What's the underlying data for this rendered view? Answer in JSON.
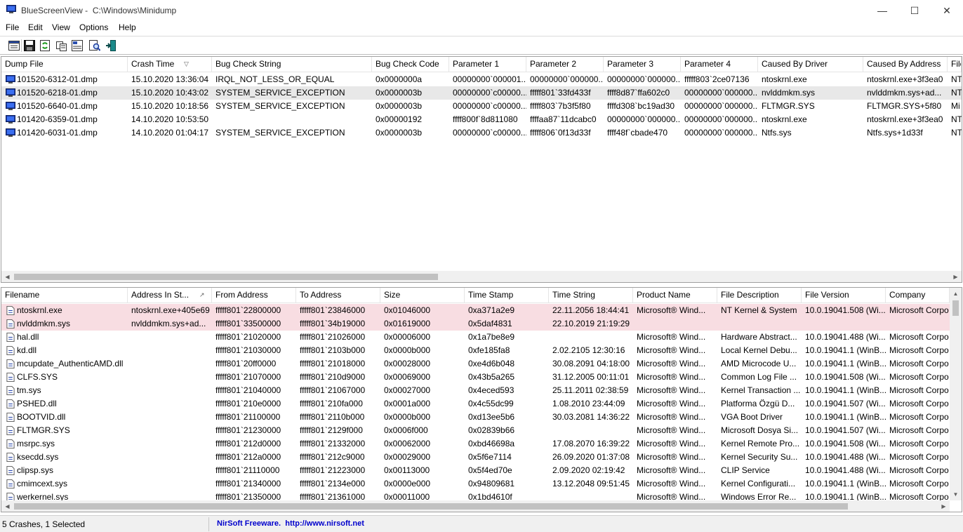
{
  "window": {
    "app_name": "BlueScreenView",
    "path": "C:\\Windows\\Minidump",
    "minimize": "—",
    "maximize": "☐",
    "close": "✕"
  },
  "menu": [
    "File",
    "Edit",
    "View",
    "Options",
    "Help"
  ],
  "toolbar": {
    "icons": [
      "options-icon",
      "save-icon",
      "refresh-icon",
      "copy-icon",
      "properties-icon",
      "find-icon",
      "exit-icon"
    ]
  },
  "crashes": {
    "columns": [
      "Dump File",
      "Crash Time",
      "Bug Check String",
      "Bug Check Code",
      "Parameter 1",
      "Parameter 2",
      "Parameter 3",
      "Parameter 4",
      "Caused By Driver",
      "Caused By Address",
      "File"
    ],
    "sort_indicator": "▽",
    "rows": [
      [
        "101520-6312-01.dmp",
        "15.10.2020 13:36:04",
        "IRQL_NOT_LESS_OR_EQUAL",
        "0x0000000a",
        "00000000`000001...",
        "00000000`000000...",
        "00000000`000000...",
        "fffff803`2ce07136",
        "ntoskrnl.exe",
        "ntoskrnl.exe+3f3ea0",
        "NT"
      ],
      [
        "101520-6218-01.dmp",
        "15.10.2020 10:43:02",
        "SYSTEM_SERVICE_EXCEPTION",
        "0x0000003b",
        "00000000`c00000...",
        "fffff801`33fd433f",
        "ffff8d87`ffa602c0",
        "00000000`000000...",
        "nvlddmkm.sys",
        "nvlddmkm.sys+ad...",
        "NT"
      ],
      [
        "101520-6640-01.dmp",
        "15.10.2020 10:18:56",
        "SYSTEM_SERVICE_EXCEPTION",
        "0x0000003b",
        "00000000`c00000...",
        "fffff803`7b3f5f80",
        "ffffd308`bc19ad30",
        "00000000`000000...",
        "FLTMGR.SYS",
        "FLTMGR.SYS+5f80",
        "Mi"
      ],
      [
        "101420-6359-01.dmp",
        "14.10.2020 10:53:50",
        "",
        "0x00000192",
        "ffff800f`8d811080",
        "ffffaa87`11dcabc0",
        "00000000`000000...",
        "00000000`000000...",
        "ntoskrnl.exe",
        "ntoskrnl.exe+3f3ea0",
        "NT"
      ],
      [
        "101420-6031-01.dmp",
        "14.10.2020 01:04:17",
        "SYSTEM_SERVICE_EXCEPTION",
        "0x0000003b",
        "00000000`c00000...",
        "fffff806`0f13d33f",
        "ffff48f`cbade470",
        "00000000`000000...",
        "Ntfs.sys",
        "Ntfs.sys+1d33f",
        "NT"
      ]
    ]
  },
  "drivers": {
    "columns": [
      "Filename",
      "Address In St...",
      "From Address",
      "To Address",
      "Size",
      "Time Stamp",
      "Time String",
      "Product Name",
      "File Description",
      "File Version",
      "Company"
    ],
    "sort_indicator": "↗",
    "rows": [
      [
        "ntoskrnl.exe",
        "ntoskrnl.exe+405e69",
        "fffff801`22800000",
        "fffff801`23846000",
        "0x01046000",
        "0xa371a2e9",
        "22.11.2056 18:44:41",
        "Microsoft® Wind...",
        "NT Kernel & System",
        "10.0.19041.508 (Wi...",
        "Microsoft Corpo"
      ],
      [
        "nvlddmkm.sys",
        "nvlddmkm.sys+ad...",
        "fffff801`33500000",
        "fffff801`34b19000",
        "0x01619000",
        "0x5daf4831",
        "22.10.2019 21:19:29",
        "",
        "",
        "",
        ""
      ],
      [
        "hal.dll",
        "",
        "fffff801`21020000",
        "fffff801`21026000",
        "0x00006000",
        "0x1a7be8e9",
        "",
        "Microsoft® Wind...",
        "Hardware Abstract...",
        "10.0.19041.488 (Wi...",
        "Microsoft Corpo"
      ],
      [
        "kd.dll",
        "",
        "fffff801`21030000",
        "fffff801`2103b000",
        "0x0000b000",
        "0xfe185fa8",
        "2.02.2105 12:30:16",
        "Microsoft® Wind...",
        "Local Kernel Debu...",
        "10.0.19041.1 (WinB...",
        "Microsoft Corpo"
      ],
      [
        "mcupdate_AuthenticAMD.dll",
        "",
        "fffff801`20ff0000",
        "fffff801`21018000",
        "0x00028000",
        "0xe4d6b048",
        "30.08.2091 04:18:00",
        "Microsoft® Wind...",
        "AMD Microcode U...",
        "10.0.19041.1 (WinB...",
        "Microsoft Corpo"
      ],
      [
        "CLFS.SYS",
        "",
        "fffff801`21070000",
        "fffff801`210d9000",
        "0x00069000",
        "0x43b5a265",
        "31.12.2005 00:11:01",
        "Microsoft® Wind...",
        "Common Log File ...",
        "10.0.19041.508 (Wi...",
        "Microsoft Corpo"
      ],
      [
        "tm.sys",
        "",
        "fffff801`21040000",
        "fffff801`21067000",
        "0x00027000",
        "0x4eced593",
        "25.11.2011 02:38:59",
        "Microsoft® Wind...",
        "Kernel Transaction ...",
        "10.0.19041.1 (WinB...",
        "Microsoft Corpo"
      ],
      [
        "PSHED.dll",
        "",
        "fffff801`210e0000",
        "fffff801`210fa000",
        "0x0001a000",
        "0x4c55dc99",
        "1.08.2010 23:44:09",
        "Microsoft® Wind...",
        "Platforma Özgü D...",
        "10.0.19041.507 (Wi...",
        "Microsoft Corpo"
      ],
      [
        "BOOTVID.dll",
        "",
        "fffff801`21100000",
        "fffff801`2110b000",
        "0x0000b000",
        "0xd13ee5b6",
        "30.03.2081 14:36:22",
        "Microsoft® Wind...",
        "VGA Boot Driver",
        "10.0.19041.1 (WinB...",
        "Microsoft Corpo"
      ],
      [
        "FLTMGR.SYS",
        "",
        "fffff801`21230000",
        "fffff801`2129f000",
        "0x0006f000",
        "0x02839b66",
        "",
        "Microsoft® Wind...",
        "Microsoft Dosya Si...",
        "10.0.19041.507 (Wi...",
        "Microsoft Corpo"
      ],
      [
        "msrpc.sys",
        "",
        "fffff801`212d0000",
        "fffff801`21332000",
        "0x00062000",
        "0xbd46698a",
        "17.08.2070 16:39:22",
        "Microsoft® Wind...",
        "Kernel Remote Pro...",
        "10.0.19041.508 (Wi...",
        "Microsoft Corpo"
      ],
      [
        "ksecdd.sys",
        "",
        "fffff801`212a0000",
        "fffff801`212c9000",
        "0x00029000",
        "0x5f6e7114",
        "26.09.2020 01:37:08",
        "Microsoft® Wind...",
        "Kernel Security Su...",
        "10.0.19041.488 (Wi...",
        "Microsoft Corpo"
      ],
      [
        "clipsp.sys",
        "",
        "fffff801`21110000",
        "fffff801`21223000",
        "0x00113000",
        "0x5f4ed70e",
        "2.09.2020 02:19:42",
        "Microsoft® Wind...",
        "CLIP Service",
        "10.0.19041.488 (Wi...",
        "Microsoft Corpo"
      ],
      [
        "cmimcext.sys",
        "",
        "fffff801`21340000",
        "fffff801`2134e000",
        "0x0000e000",
        "0x94809681",
        "13.12.2048 09:51:45",
        "Microsoft® Wind...",
        "Kernel Configurati...",
        "10.0.19041.1 (WinB...",
        "Microsoft Corpo"
      ],
      [
        "werkernel.sys",
        "",
        "fffff801`21350000",
        "fffff801`21361000",
        "0x00011000",
        "0x1bd4610f",
        "",
        "Microsoft® Wind...",
        "Windows Error Re...",
        "10.0.19041.1 (WinB...",
        "Microsoft Corpo"
      ]
    ]
  },
  "status": {
    "summary": "5 Crashes, 1 Selected",
    "vendor": "NirSoft Freeware.",
    "url": "http://www.nirsoft.net"
  },
  "colors": {
    "selected_row": "#e8e8e8",
    "highlight_row": "#f8dde2",
    "link": "#0000ff"
  }
}
